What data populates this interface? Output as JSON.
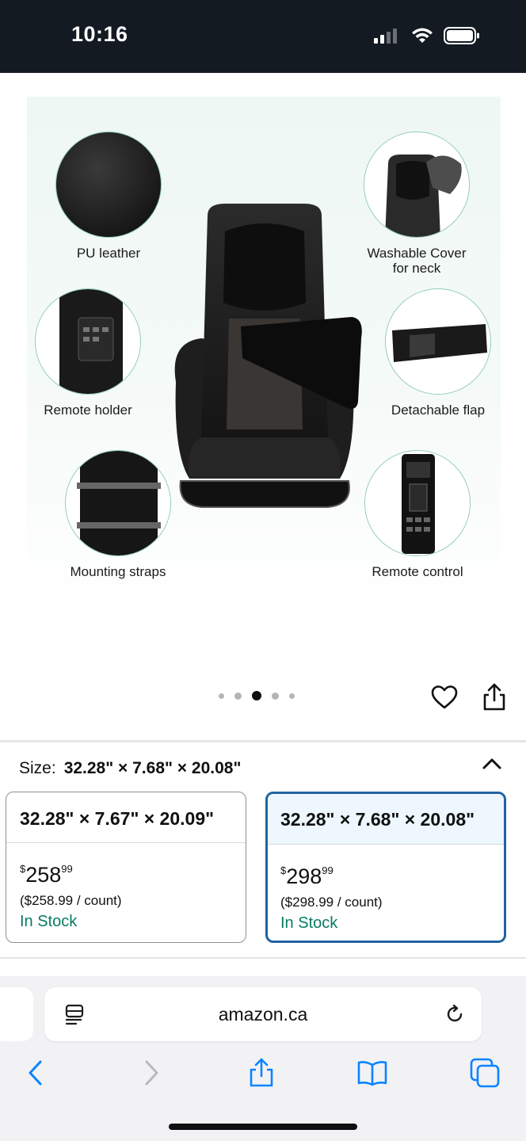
{
  "status_bar": {
    "time": "10:16"
  },
  "product_image": {
    "features": {
      "pu_leather": "PU leather",
      "washable_cover": "Washable Cover\nfor neck",
      "remote_holder": "Remote holder",
      "detachable_flap": "Detachable flap",
      "mounting_straps": "Mounting straps",
      "remote_control": "Remote control"
    }
  },
  "carousel": {
    "total": 5,
    "active_index": 2
  },
  "size": {
    "label": "Size:",
    "selected_value": "32.28\" × 7.68\" × 20.08\"",
    "options": [
      {
        "dimensions": "32.28\" × 7.67\" × 20.09\"",
        "price_symbol": "$",
        "price_whole": "258",
        "price_fraction": "99",
        "unit_price": "($258.99 / count)",
        "stock": "In Stock",
        "selected": false
      },
      {
        "dimensions": "32.28\" × 7.68\" × 20.08\"",
        "price_symbol": "$",
        "price_whole": "298",
        "price_fraction": "99",
        "unit_price": "($298.99 / count)",
        "stock": "In Stock",
        "selected": true
      }
    ]
  },
  "browser": {
    "url": "amazon.ca"
  },
  "colors": {
    "status_bar_bg": "#131a22",
    "selected_border": "#2162a1",
    "in_stock": "#067d62",
    "ios_blue": "#0a84ff"
  },
  "icons": [
    "signal-icon",
    "wifi-icon",
    "battery-icon",
    "heart-icon",
    "share-icon",
    "chevron-up-icon",
    "reader-icon",
    "reload-icon",
    "back-icon",
    "forward-icon",
    "bookmarks-icon",
    "tabs-icon"
  ]
}
